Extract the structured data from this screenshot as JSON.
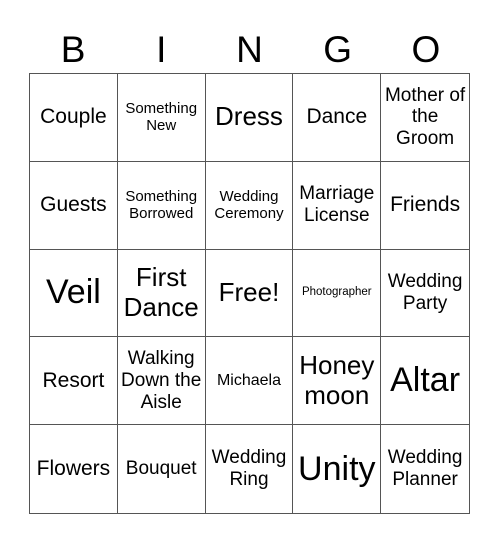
{
  "header": [
    "B",
    "I",
    "N",
    "G",
    "O"
  ],
  "cells": [
    {
      "text": "Couple",
      "size": "s-m"
    },
    {
      "text": "Something New",
      "size": "s-xs"
    },
    {
      "text": "Dress",
      "size": "s-l"
    },
    {
      "text": "Dance",
      "size": "s-m"
    },
    {
      "text": "Mother of the Groom",
      "size": "s-ms"
    },
    {
      "text": "Guests",
      "size": "s-m"
    },
    {
      "text": "Something Borrowed",
      "size": "s-xs"
    },
    {
      "text": "Wedding Ceremony",
      "size": "s-xs"
    },
    {
      "text": "Marriage License",
      "size": "s-ms"
    },
    {
      "text": "Friends",
      "size": "s-m"
    },
    {
      "text": "Veil",
      "size": "s-xl"
    },
    {
      "text": "First Dance",
      "size": "s-l"
    },
    {
      "text": "Free!",
      "size": "s-l"
    },
    {
      "text": "Photographer",
      "size": "s-xxs"
    },
    {
      "text": "Wedding Party",
      "size": "s-ms"
    },
    {
      "text": "Resort",
      "size": "s-m"
    },
    {
      "text": "Walking Down the Aisle",
      "size": "s-ms"
    },
    {
      "text": "Michaela",
      "size": "s-s"
    },
    {
      "text": "Honey moon",
      "size": "s-l"
    },
    {
      "text": "Altar",
      "size": "s-xl"
    },
    {
      "text": "Flowers",
      "size": "s-m"
    },
    {
      "text": "Bouquet",
      "size": "s-ms"
    },
    {
      "text": "Wedding Ring",
      "size": "s-ms"
    },
    {
      "text": "Unity",
      "size": "s-xl"
    },
    {
      "text": "Wedding Planner",
      "size": "s-ms"
    }
  ]
}
